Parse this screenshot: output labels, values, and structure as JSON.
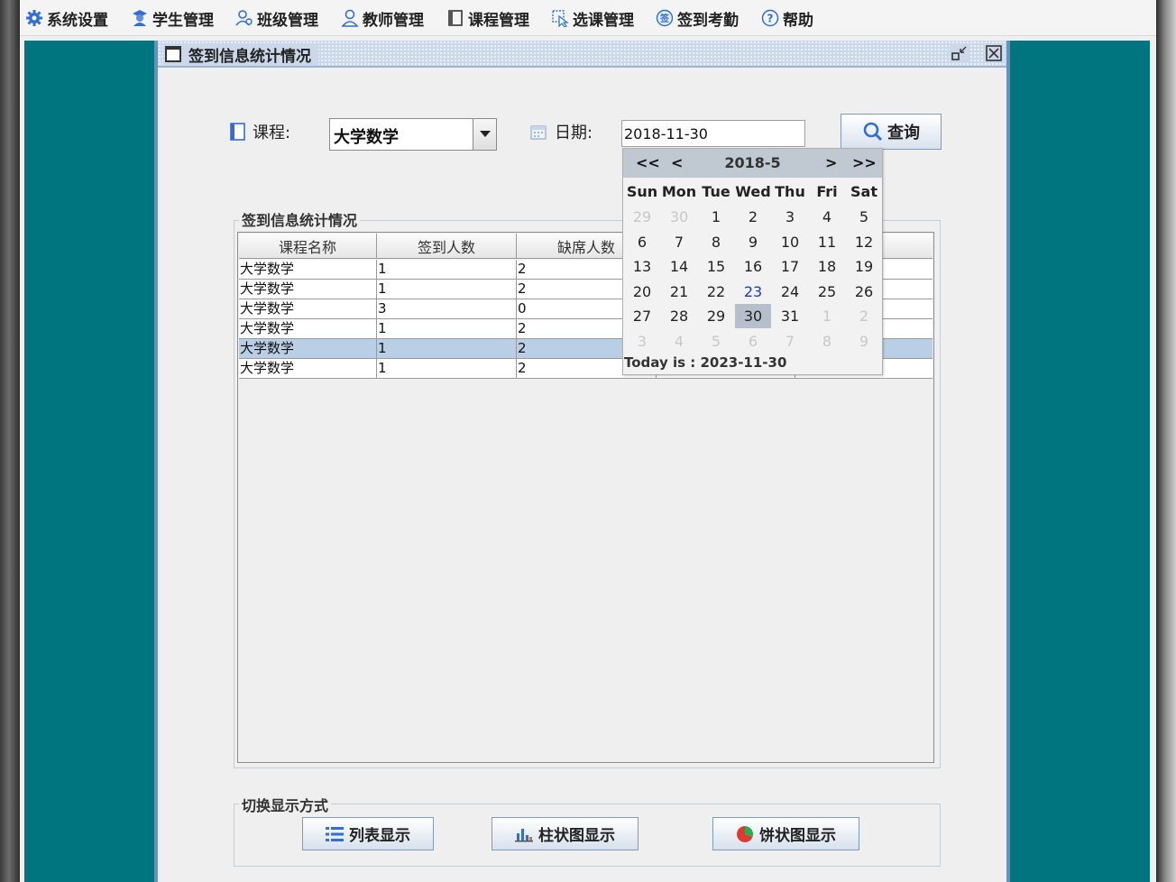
{
  "menu": {
    "items": [
      {
        "label": "系统设置",
        "icon": "gear-icon"
      },
      {
        "label": "学生管理",
        "icon": "student-icon"
      },
      {
        "label": "班级管理",
        "icon": "class-icon"
      },
      {
        "label": "教师管理",
        "icon": "teacher-icon"
      },
      {
        "label": "课程管理",
        "icon": "course-icon"
      },
      {
        "label": "选课管理",
        "icon": "select-course-icon"
      },
      {
        "label": "签到考勤",
        "icon": "checkin-icon"
      },
      {
        "label": "帮助",
        "icon": "help-icon"
      }
    ]
  },
  "frame": {
    "title": "签到信息统计情况"
  },
  "filter": {
    "course_label": "课程:",
    "course_value": "大学数学",
    "date_label": "日期:",
    "date_value": "2018-11-30",
    "query_label": "查询"
  },
  "stats": {
    "legend": "签到信息统计情况",
    "columns": [
      "课程名称",
      "签到人数",
      "缺席人数",
      "",
      ""
    ],
    "rows": [
      [
        "大学数学",
        "1",
        "2",
        "",
        ""
      ],
      [
        "大学数学",
        "1",
        "2",
        "",
        ""
      ],
      [
        "大学数学",
        "3",
        "0",
        "",
        ""
      ],
      [
        "大学数学",
        "1",
        "2",
        "",
        ""
      ],
      [
        "大学数学",
        "1",
        "2",
        "",
        ""
      ],
      [
        "大学数学",
        "1",
        "2",
        "",
        ""
      ]
    ],
    "selected_row": 4
  },
  "calendar": {
    "nav_prev_year": "<<",
    "nav_prev_month": "<",
    "month": "2018-5",
    "nav_next_month": ">",
    "nav_next_year": ">>",
    "weekdays": [
      "Sun",
      "Mon",
      "Tue",
      "Wed",
      "Thu",
      "Fri",
      "Sat"
    ],
    "weeks": [
      [
        "29",
        "30",
        "1",
        "2",
        "3",
        "4",
        "5"
      ],
      [
        "6",
        "7",
        "8",
        "9",
        "10",
        "11",
        "12"
      ],
      [
        "13",
        "14",
        "15",
        "16",
        "17",
        "18",
        "19"
      ],
      [
        "20",
        "21",
        "22",
        "23",
        "24",
        "25",
        "26"
      ],
      [
        "27",
        "28",
        "29",
        "30",
        "31",
        "1",
        "2"
      ],
      [
        "3",
        "4",
        "5",
        "6",
        "7",
        "8",
        "9"
      ]
    ],
    "selected_day": "30",
    "today_day": "23",
    "footer": "Today is : 2023-11-30"
  },
  "display_mode": {
    "legend": "切换显示方式",
    "list_label": "列表显示",
    "bar_label": "柱状图显示",
    "pie_label": "饼状图显示"
  },
  "colors": {
    "desktop": "#007580",
    "frame_border": "#6e8fb9",
    "selected_row": "#b8cfe5",
    "today": "#1a3ad6"
  }
}
